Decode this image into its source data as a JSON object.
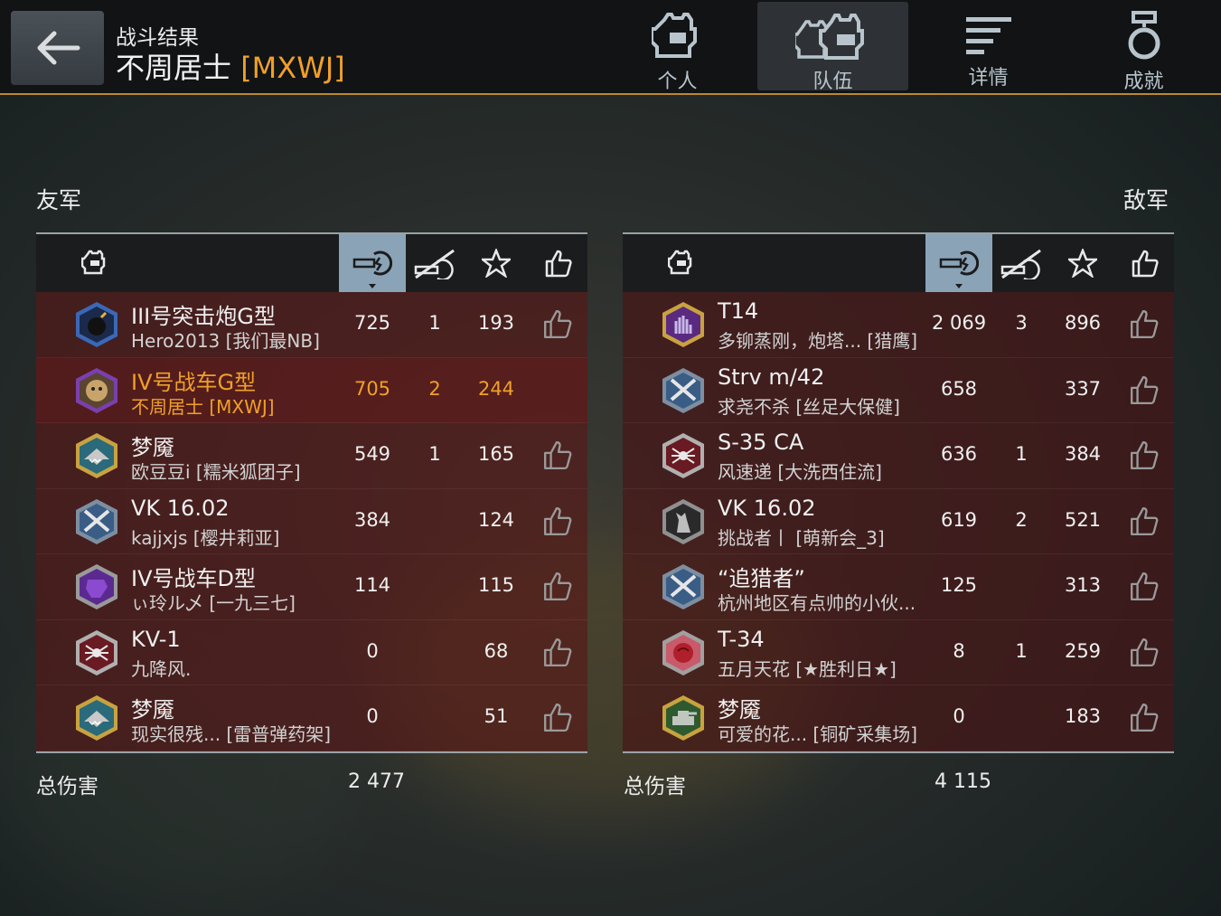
{
  "header": {
    "subtitle": "战斗结果",
    "player_name": "不周居士",
    "player_clan": "[MXWJ]",
    "tabs": [
      {
        "label": "个人",
        "icon": "tank-icon"
      },
      {
        "label": "队伍",
        "icon": "team-icon"
      },
      {
        "label": "详情",
        "icon": "details-icon"
      },
      {
        "label": "成就",
        "icon": "medal-icon"
      }
    ],
    "active_tab": "队伍"
  },
  "allies": {
    "title": "友军",
    "total_label": "总伤害",
    "total_damage": "2 477",
    "rows": [
      {
        "tank": "III号突击炮G型",
        "player": "Hero2013 [我们最NB]",
        "damage": "725",
        "kills": "1",
        "exp": "193",
        "badge": "bomb",
        "me": false
      },
      {
        "tank": "IV号战车G型",
        "player": "不周居士 [MXWJ]",
        "damage": "705",
        "kills": "2",
        "exp": "244",
        "badge": "tiger",
        "me": true
      },
      {
        "tank": "梦魇",
        "player": "欧豆豆i [糯米狐团子]",
        "damage": "549",
        "kills": "1",
        "exp": "165",
        "badge": "shark",
        "me": false
      },
      {
        "tank": "VK 16.02",
        "player": "kajjxjs [樱井莉亚]",
        "damage": "384",
        "kills": "",
        "exp": "124",
        "badge": "rifles",
        "me": false
      },
      {
        "tank": "IV号战车D型",
        "player": "ぃ玲ル乄 [一九三七]",
        "damage": "114",
        "kills": "",
        "exp": "115",
        "badge": "purple",
        "me": false
      },
      {
        "tank": "KV-1",
        "player": "九降风.",
        "damage": "0",
        "kills": "",
        "exp": "68",
        "badge": "spider",
        "me": false
      },
      {
        "tank": "梦魇",
        "player": "现实很残... [雷普弹药架]",
        "damage": "0",
        "kills": "",
        "exp": "51",
        "badge": "shark",
        "me": false
      }
    ]
  },
  "enemies": {
    "title": "敌军",
    "total_label": "总伤害",
    "total_damage": "4 115",
    "rows": [
      {
        "tank": "T14",
        "player": "多铆蒸刚，炮塔... [猎鹰]",
        "damage": "2 069",
        "kills": "3",
        "exp": "896",
        "badge": "hand"
      },
      {
        "tank": "Strv m/42",
        "player": "求尧不杀 [丝足大保健]",
        "damage": "658",
        "kills": "",
        "exp": "337",
        "badge": "rifles"
      },
      {
        "tank": "S-35 CA",
        "player": "风速递 [大洗西住流]",
        "damage": "636",
        "kills": "1",
        "exp": "384",
        "badge": "spider"
      },
      {
        "tank": "VK 16.02",
        "player": "挑战者丨 [萌新会_3]",
        "damage": "619",
        "kills": "2",
        "exp": "521",
        "badge": "wolf"
      },
      {
        "tank": "“追猎者”",
        "player": "杭州地区有点帅的小伙...",
        "damage": "125",
        "kills": "",
        "exp": "313",
        "badge": "rifles"
      },
      {
        "tank": "T-34",
        "player": "五月天花 [★胜利日★]",
        "damage": "8",
        "kills": "1",
        "exp": "259",
        "badge": "rose"
      },
      {
        "tank": "梦魇",
        "player": "可爱的花... [铜矿采集场]",
        "damage": "0",
        "kills": "",
        "exp": "183",
        "badge": "greentank"
      }
    ]
  },
  "colors": {
    "accent": "#f0a028",
    "row_bg": "#581616",
    "header_sel": "#8aa3b6"
  }
}
